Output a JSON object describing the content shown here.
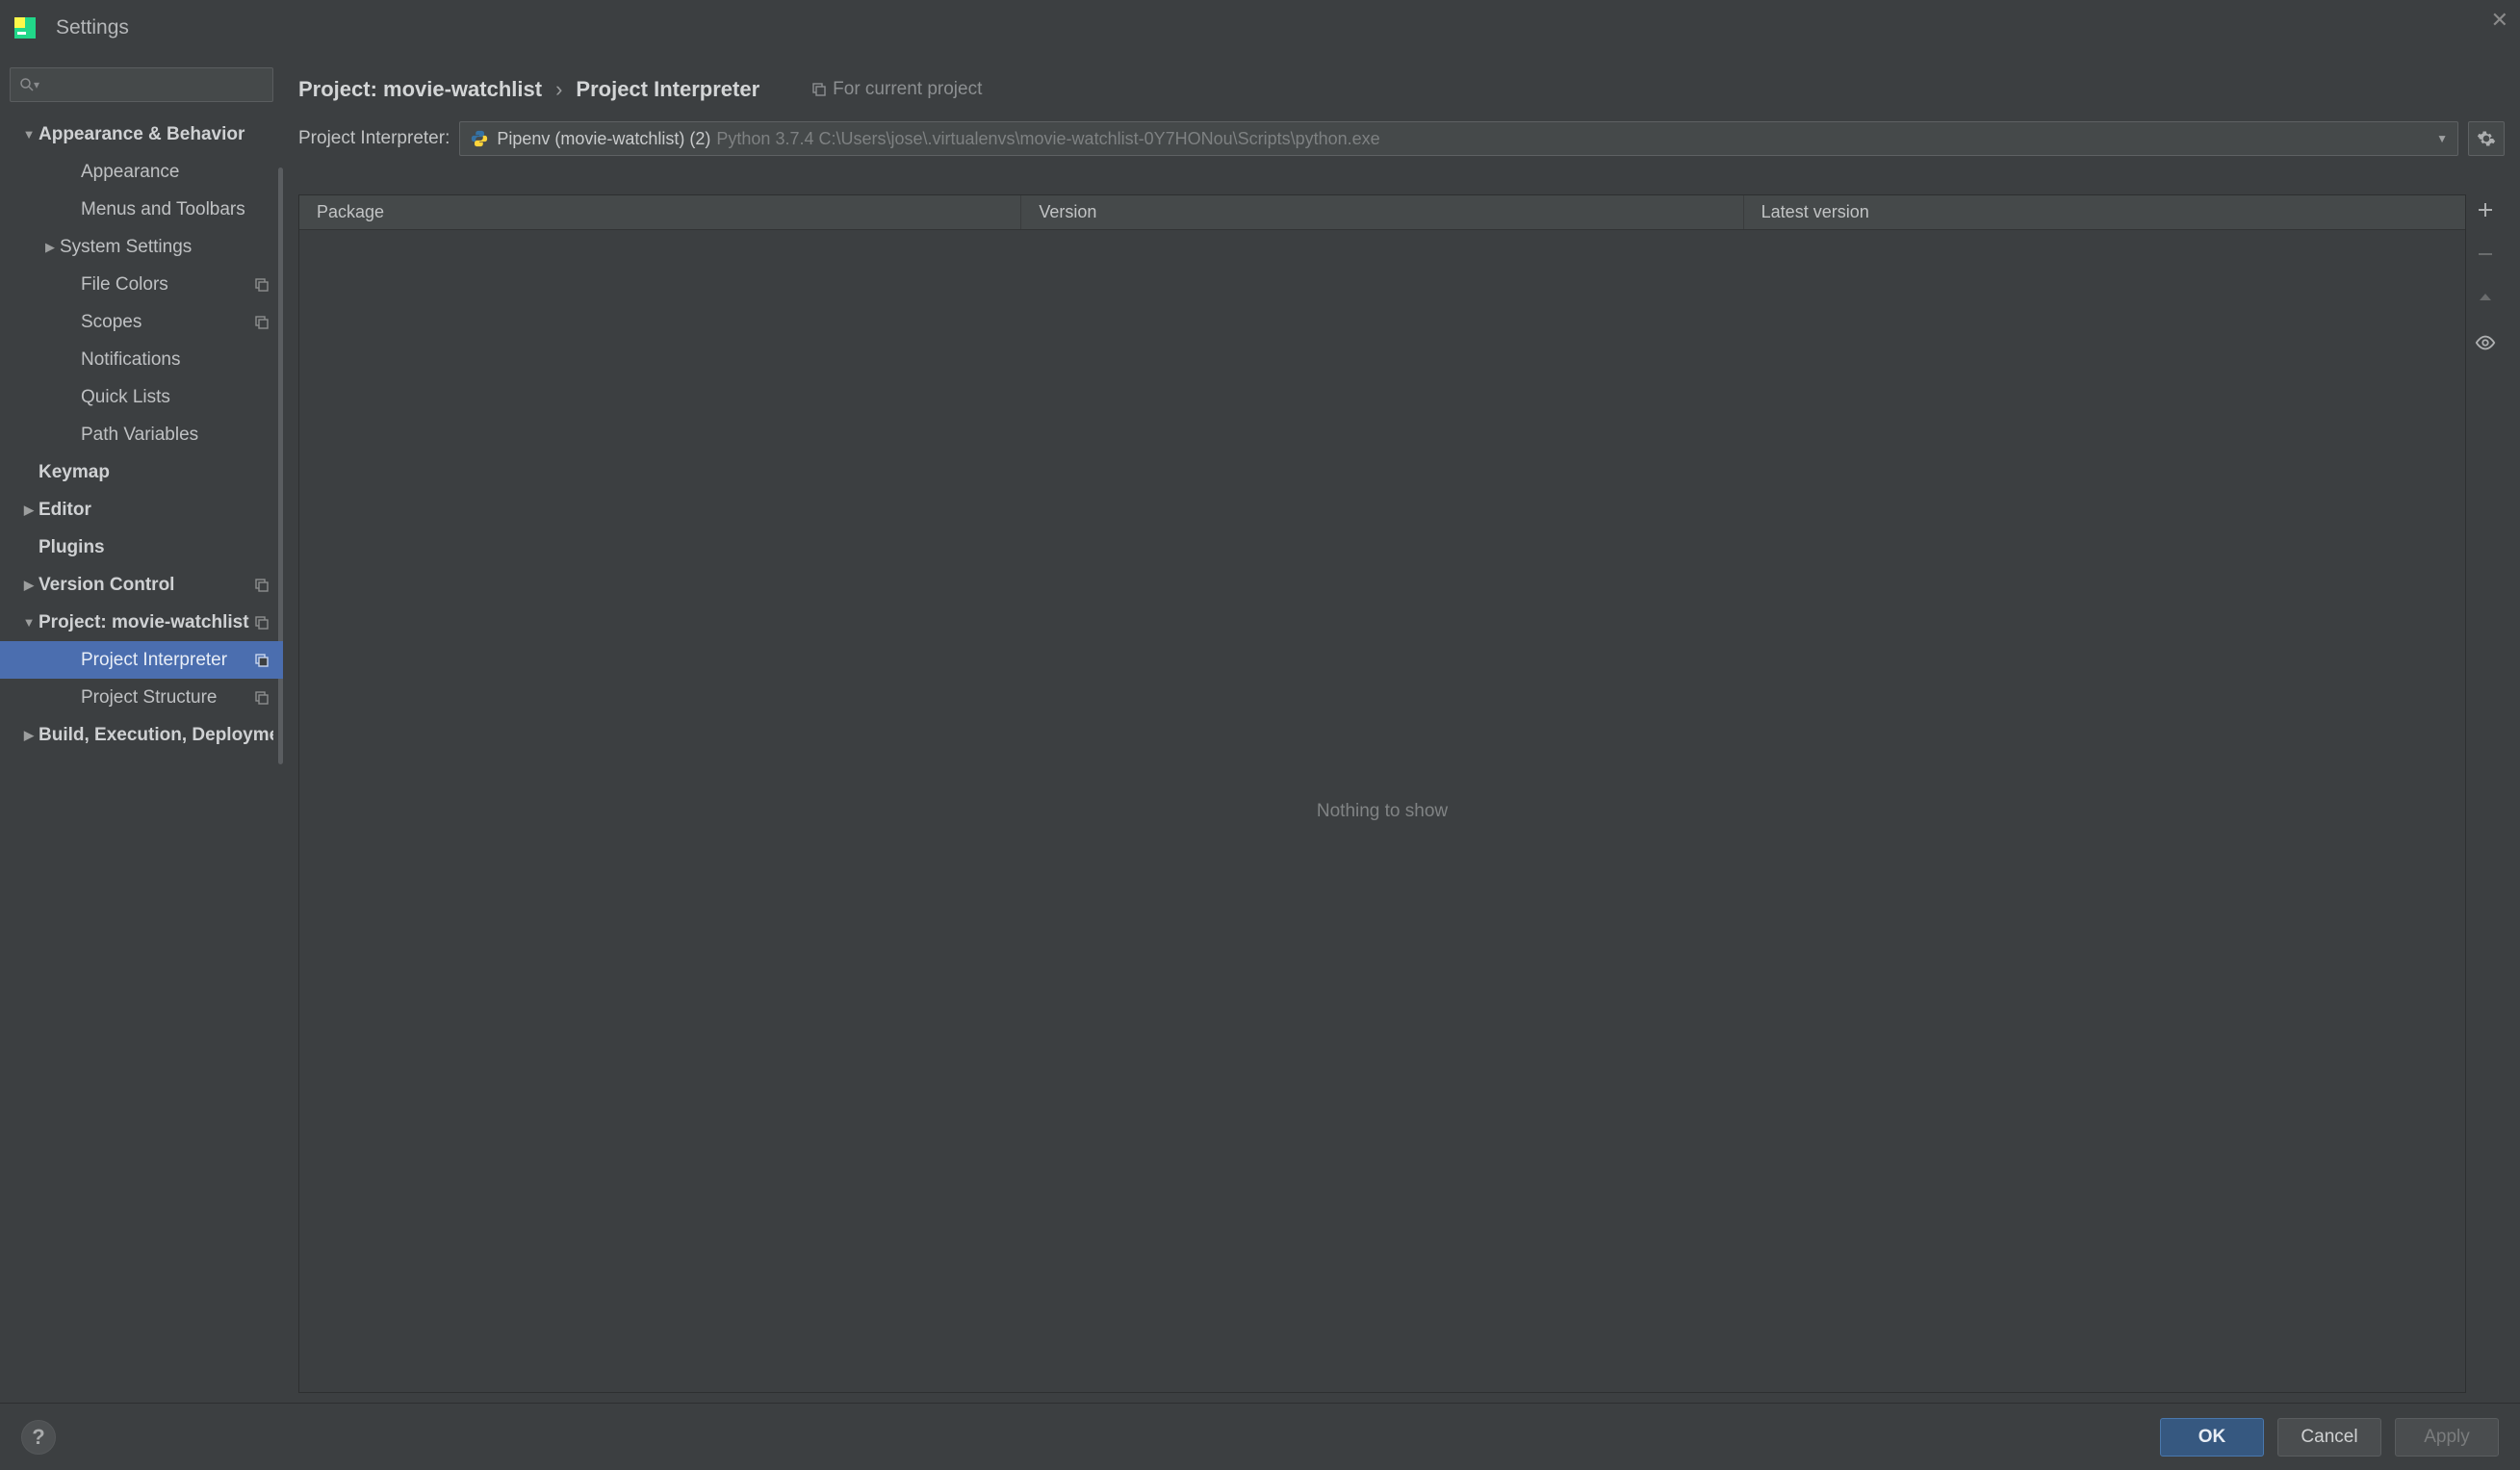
{
  "titlebar": {
    "title": "Settings"
  },
  "sidebar": {
    "items": [
      {
        "label": "Appearance & Behavior",
        "bold": true,
        "arrow": "expanded",
        "indent": 0
      },
      {
        "label": "Appearance",
        "arrow": "none",
        "indent": 2
      },
      {
        "label": "Menus and Toolbars",
        "arrow": "none",
        "indent": 2
      },
      {
        "label": "System Settings",
        "arrow": "collapsed",
        "indent": 1
      },
      {
        "label": "File Colors",
        "arrow": "none",
        "indent": 2,
        "projIcon": true
      },
      {
        "label": "Scopes",
        "arrow": "none",
        "indent": 2,
        "projIcon": true
      },
      {
        "label": "Notifications",
        "arrow": "none",
        "indent": 2
      },
      {
        "label": "Quick Lists",
        "arrow": "none",
        "indent": 2
      },
      {
        "label": "Path Variables",
        "arrow": "none",
        "indent": 2
      },
      {
        "label": "Keymap",
        "bold": true,
        "arrow": "none",
        "indent": 0
      },
      {
        "label": "Editor",
        "bold": true,
        "arrow": "collapsed",
        "indent": 0
      },
      {
        "label": "Plugins",
        "bold": true,
        "arrow": "none",
        "indent": 0
      },
      {
        "label": "Version Control",
        "bold": true,
        "arrow": "collapsed",
        "indent": 0,
        "projIcon": true
      },
      {
        "label": "Project: movie-watchlist",
        "bold": true,
        "arrow": "expanded",
        "indent": 0,
        "projIcon": true
      },
      {
        "label": "Project Interpreter",
        "arrow": "none",
        "indent": 2,
        "projIcon": true,
        "selected": true
      },
      {
        "label": "Project Structure",
        "arrow": "none",
        "indent": 2,
        "projIcon": true
      },
      {
        "label": "Build, Execution, Deployment",
        "bold": true,
        "arrow": "collapsed",
        "indent": 0
      }
    ]
  },
  "breadcrumb": {
    "seg1": "Project: movie-watchlist",
    "seg2": "Project Interpreter",
    "hint": "For current project"
  },
  "interpreter": {
    "label": "Project Interpreter:",
    "name": "Pipenv (movie-watchlist) (2)",
    "path": "Python 3.7.4 C:\\Users\\jose\\.virtualenvs\\movie-watchlist-0Y7HONou\\Scripts\\python.exe"
  },
  "packages": {
    "columns": {
      "package": "Package",
      "version": "Version",
      "latest": "Latest version"
    },
    "empty": "Nothing to show"
  },
  "footer": {
    "ok": "OK",
    "cancel": "Cancel",
    "apply": "Apply"
  }
}
